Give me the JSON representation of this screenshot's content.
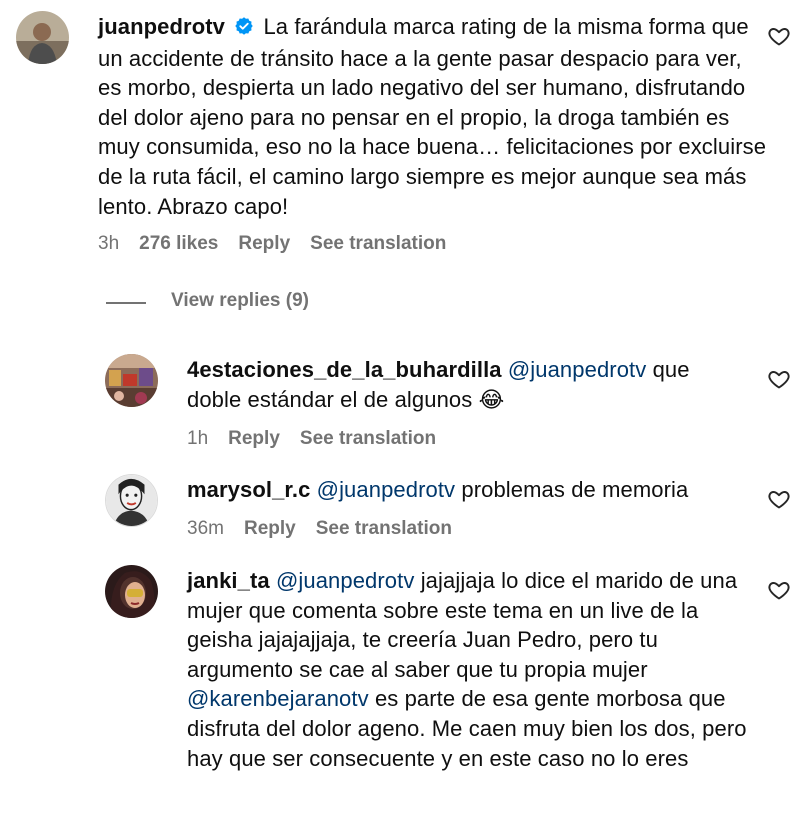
{
  "comment": {
    "username": "juanpedrotv",
    "text": "La farándula marca rating de la misma forma que un accidente de tránsito hace a la gente pasar despacio para ver, es morbo, despierta un lado negativo del ser humano, disfrutando del dolor ajeno para no pensar en el propio, la droga también es muy consumida, eso no la hace buena… felicitaciones por excluirse de la ruta fácil, el camino largo siempre es mejor aunque sea más lento. Abrazo capo!",
    "time": "3h",
    "likes": "276 likes",
    "reply": "Reply",
    "translate": "See translation",
    "view_replies": "View replies (9)"
  },
  "replies": [
    {
      "username": "4estaciones_de_la_buhardilla",
      "mention": "@juanpedrotv",
      "text": "que doble estándar el de algunos",
      "emoji": "😂",
      "time": "1h",
      "reply": "Reply",
      "translate": "See translation"
    },
    {
      "username": "marysol_r.c",
      "mention": "@juanpedrotv",
      "text": "problemas de memoria",
      "time": "36m",
      "reply": "Reply",
      "translate": "See translation"
    },
    {
      "username": "janki_ta",
      "mention": "@juanpedrotv",
      "text": "jajajjaja lo dice el marido de una mujer que comenta sobre este tema en un live de la geisha jajajajjaja, te creería Juan Pedro, pero tu argumento se cae al saber que tu propia mujer",
      "mention2": "@karenbejaranotv",
      "text2": "es parte de esa gente morbosa que disfruta del dolor ageno. Me caen muy bien los dos, pero hay que ser consecuente y en este caso no lo eres"
    }
  ],
  "colors": {
    "text": "#0f0f0f",
    "secondary": "#737373",
    "mention": "#00376b",
    "verified": "#0095f6"
  },
  "icons": {
    "like": "heart-outline-icon",
    "verified": "verified-badge-icon"
  }
}
